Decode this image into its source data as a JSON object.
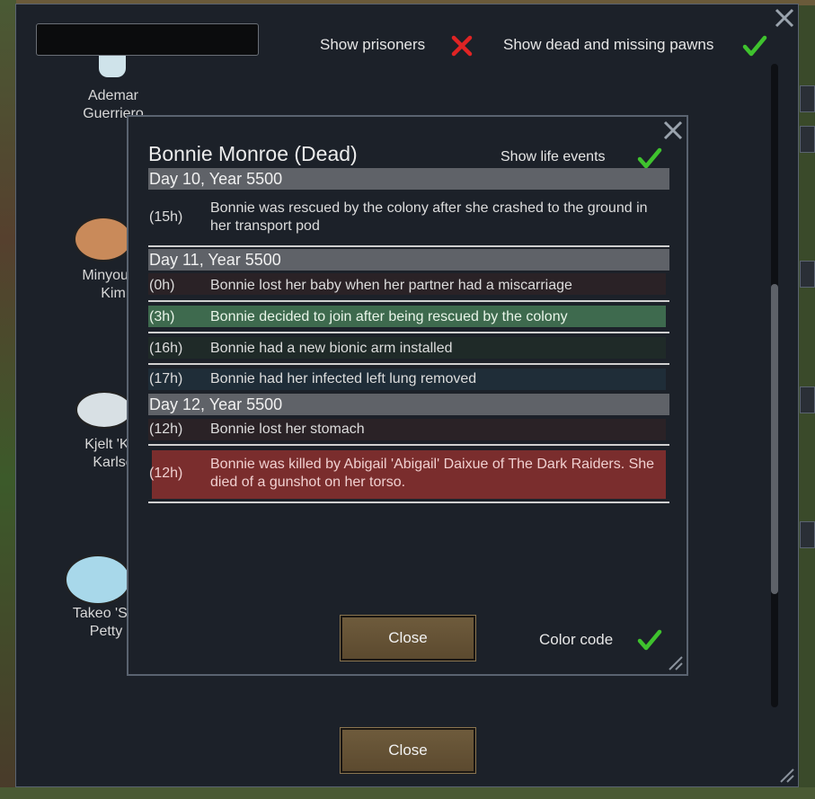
{
  "header": {
    "search": {
      "value": "",
      "placeholder": ""
    },
    "show_prisoners": {
      "label": "Show prisoners",
      "checked": false
    },
    "show_dead": {
      "label": "Show dead and missing pawns",
      "checked": true
    }
  },
  "pawns": [
    {
      "name_line1": "Ademar",
      "name_line2": "Guerriero"
    },
    {
      "name_line1": "Minyoung",
      "name_line2": "Kim"
    },
    {
      "name_line1": "Kjelt 'Kar",
      "name_line2": "Karlse"
    },
    {
      "name_line1": "Takeo 'Stu",
      "name_line2": "Petty"
    }
  ],
  "outer_close_label": "Close",
  "dialog": {
    "title": "Bonnie Monroe (Dead)",
    "show_life_events": {
      "label": "Show life events",
      "checked": true
    },
    "days": [
      {
        "header": "Day 10, Year 5500",
        "entries": [
          {
            "time": "(15h)",
            "text": "Bonnie was rescued by the colony after she crashed to the ground in her transport pod"
          }
        ]
      },
      {
        "header": "Day 11, Year 5500",
        "entries": [
          {
            "time": "(0h)",
            "text": "Bonnie lost her baby when her partner had a miscarriage"
          },
          {
            "time": "(3h)",
            "text": "Bonnie decided to join after being rescued by the colony"
          },
          {
            "time": "(16h)",
            "text": "Bonnie had a new bionic arm installed"
          },
          {
            "time": "(17h)",
            "text": "Bonnie had her infected left lung removed"
          }
        ]
      },
      {
        "header": "Day 12, Year 5500",
        "entries": [
          {
            "time": "(12h)",
            "text": "Bonnie lost her stomach"
          },
          {
            "time": "(12h)",
            "text": "Bonnie was killed by Abigail 'Abigail' Daixue of The Dark Raiders. She died of a gunshot on her torso."
          }
        ]
      }
    ],
    "close_label": "Close",
    "color_code": {
      "label": "Color code",
      "checked": true
    }
  },
  "colors": {
    "check_green": "#3fc22e",
    "x_red": "#e02424",
    "entry_bad": "#2a2226",
    "entry_good": "#3e6a4e",
    "entry_neutral": "#1f2a28",
    "entry_medical": "#1f2d38",
    "entry_death": "#7a2d2d"
  }
}
